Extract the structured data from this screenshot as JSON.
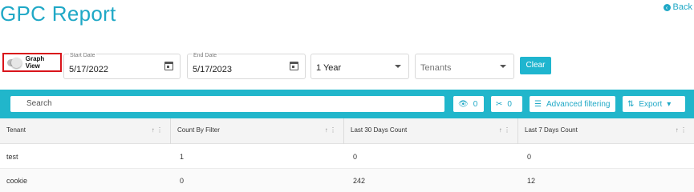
{
  "header": {
    "title": "GPC Report",
    "back_label": "Back"
  },
  "filters": {
    "graph_view_label": "Graph View",
    "start_date": {
      "label": "Start Date",
      "value": "5/17/2022"
    },
    "end_date": {
      "label": "End Date",
      "value": "5/17/2023"
    },
    "period": {
      "value": "1 Year"
    },
    "tenants": {
      "placeholder": "Tenants"
    },
    "clear_label": "Clear"
  },
  "toolbar": {
    "search_placeholder": "Search",
    "visible_count": "0",
    "hidden_count": "0",
    "advanced_filtering_label": "Advanced filtering",
    "export_label": "Export"
  },
  "table": {
    "columns": [
      "Tenant",
      "Count By Filter",
      "Last 30 Days Count",
      "Last 7 Days Count"
    ],
    "rows": [
      [
        "test",
        "1",
        "0",
        "0"
      ],
      [
        "cookie",
        "0",
        "242",
        "12"
      ]
    ]
  },
  "colors": {
    "accent": "#1fa8c6",
    "bar": "#21b6cb",
    "highlight_border": "#d9141b"
  }
}
